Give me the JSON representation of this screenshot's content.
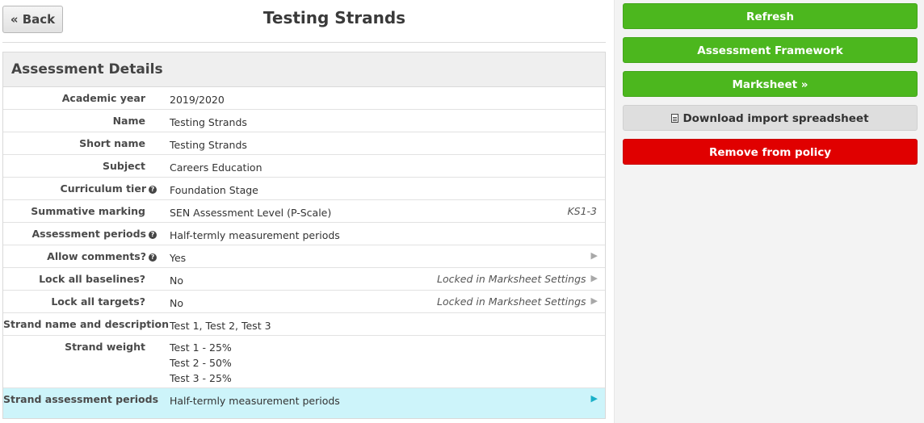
{
  "header": {
    "back_label": "« Back",
    "title": "Testing Strands"
  },
  "panel": {
    "title": "Assessment Details",
    "rows": [
      {
        "label": "Academic year",
        "value": "2019/2020"
      },
      {
        "label": "Name",
        "value": "Testing Strands"
      },
      {
        "label": "Short name",
        "value": "Testing Strands"
      },
      {
        "label": "Subject",
        "value": "Careers Education"
      },
      {
        "label": "Curriculum tier",
        "value": "Foundation Stage",
        "help": true
      },
      {
        "label": "Summative marking",
        "value": "SEN Assessment Level (P-Scale)",
        "note": "KS1-3"
      },
      {
        "label": "Assessment periods",
        "value": "Half-termly measurement periods",
        "help": true
      },
      {
        "label": "Allow comments?",
        "value": "Yes",
        "help": true
      },
      {
        "label": "Lock all baselines?",
        "value": "No",
        "note": "Locked in Marksheet Settings"
      },
      {
        "label": "Lock all targets?",
        "value": "No",
        "note": "Locked in Marksheet Settings"
      },
      {
        "label": "Strand name and description",
        "value": "Test 1, Test 2, Test 3"
      },
      {
        "label": "Strand weight",
        "lines": [
          "Test 1 - 25%",
          "Test 2 - 50%",
          "Test 3 - 25%"
        ]
      },
      {
        "label": "Strand assessment periods",
        "value": "Half-termly measurement periods"
      }
    ]
  },
  "actions": {
    "refresh": "Refresh",
    "framework": "Assessment Framework",
    "marksheet": "Marksheet »",
    "download": "Download import spreadsheet",
    "remove": "Remove from policy"
  },
  "colors": {
    "green": "#4cb71e",
    "red": "#e00000",
    "highlight": "#cdf4fa"
  },
  "icons": {
    "help": "question-circle-icon",
    "arrow": "triangle-right-icon",
    "download": "file-icon"
  }
}
